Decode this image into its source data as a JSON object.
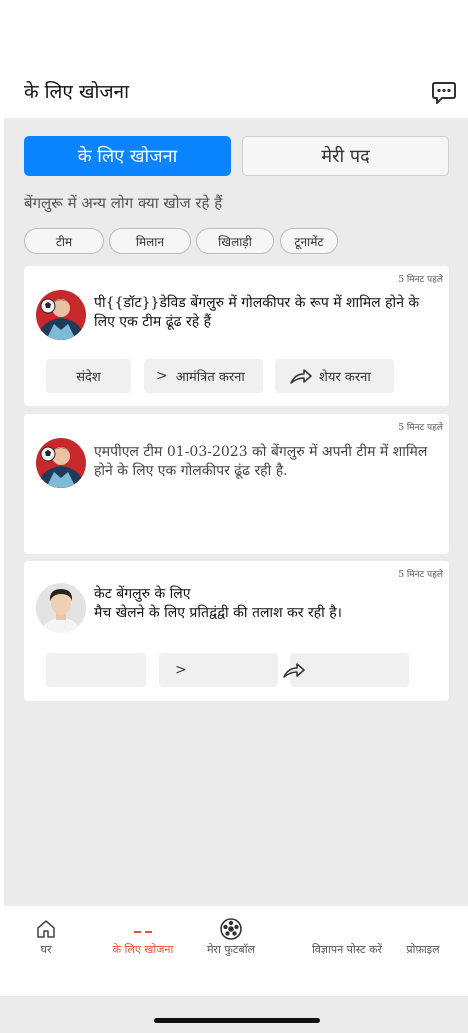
{
  "header": {
    "title": "के लिए खोजना"
  },
  "segments": {
    "active": "के लिए खोजना",
    "inactive": "मेरी पद"
  },
  "subtitle": "बेंगलुरू में अन्य लोग क्या खोज रहे हैं",
  "chips": [
    "टीम",
    "मिलान",
    "खिलाड़ी",
    "टूनामेंट"
  ],
  "posts": [
    {
      "time": "5 मिनट पहले",
      "text": "पी{{डॉट}}डेविड बेंगलुरु में गोलकीपर के रूप में शामिल होने के लिए एक टीम ढूंढ रहे हैं",
      "actions": {
        "message": "संदेश",
        "invite": "आमंत्रित करना",
        "invite_prefix": ">",
        "share": "शेयर करना"
      }
    },
    {
      "time": "5 मिनट पहले",
      "text": "एमपीएल टीम 01-03-2023 को बेंगलुरु में अपनी टीम में शामिल होने के लिए एक गोलकीपर ढूंढ रही है."
    },
    {
      "time": "5 मिनट पहले",
      "text_line1": "केट बेंगलुरु के लिए",
      "text_line2": "मैच खेलने के लिए प्रतिद्वंद्वी की तलाश कर रही है।",
      "actions": {
        "invite_prefix": ">"
      }
    }
  ],
  "nav": {
    "home": "घर",
    "search": "के लिए खोजना",
    "my_football": "मेरा फुटबॉल",
    "post_ad": "विज्ञापन पोस्ट करें",
    "profile": "प्रोफ़ाइल"
  },
  "icons": [
    "chat-bubble-icon",
    "share-arrow-icon",
    "home-icon",
    "football-icon"
  ],
  "colors": {
    "accent": "#0a84ff",
    "nav_active": "#e8503a",
    "background": "#ebebeb"
  }
}
